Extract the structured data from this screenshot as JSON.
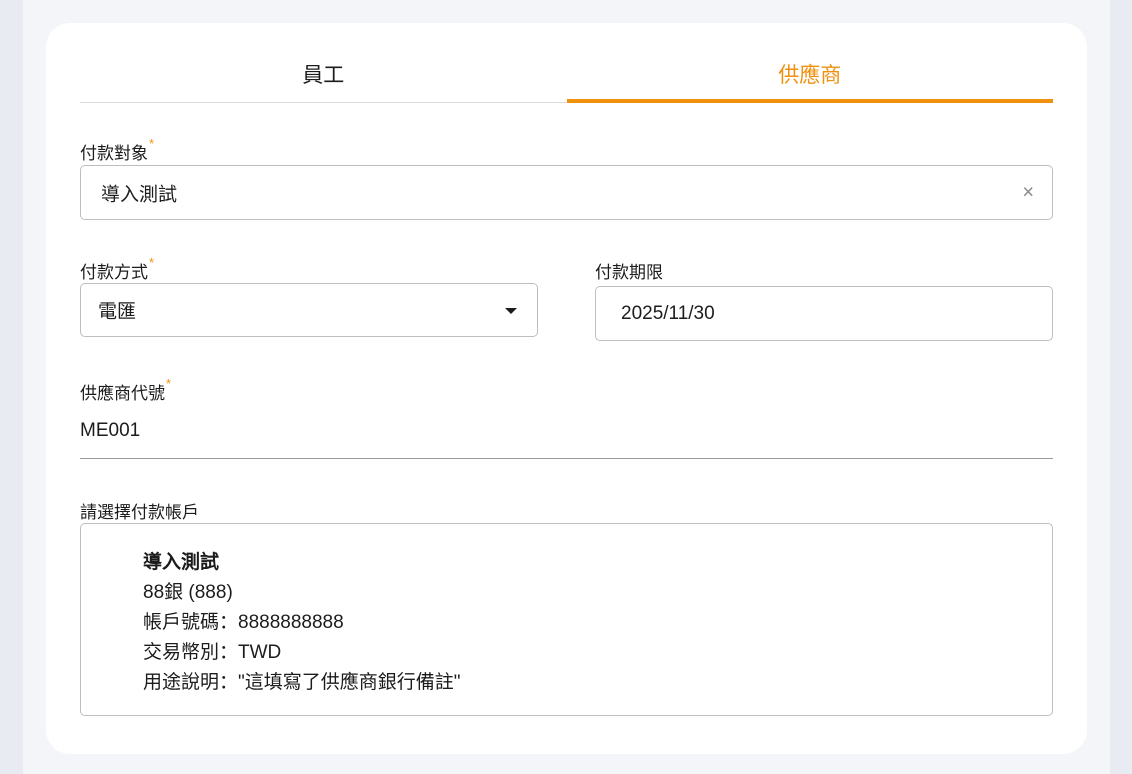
{
  "tabs": [
    {
      "label": "員工",
      "active": false
    },
    {
      "label": "供應商",
      "active": true
    }
  ],
  "payee": {
    "label": "付款對象",
    "required": "*",
    "value": "導入測試",
    "clear_icon": "×"
  },
  "method": {
    "label": "付款方式",
    "required": "*",
    "value": "電匯"
  },
  "deadline": {
    "label": "付款期限",
    "value": "2025/11/30"
  },
  "vendor_code": {
    "label": "供應商代號",
    "required": "*",
    "value": "ME001"
  },
  "account": {
    "label": "請選擇付款帳戶",
    "name": "導入測試",
    "bank": "88銀 (888)",
    "number": "帳戶號碼：8888888888",
    "currency": "交易幣別：TWD",
    "memo": "用途說明：\"這填寫了供應商銀行備註\""
  },
  "colors": {
    "accent": "#f0900f"
  }
}
